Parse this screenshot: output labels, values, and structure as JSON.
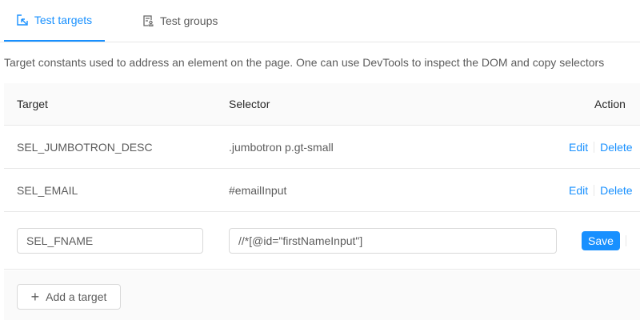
{
  "tabs": [
    {
      "label": "Test targets",
      "icon": "select-icon",
      "active": true
    },
    {
      "label": "Test groups",
      "icon": "profile-icon",
      "active": false
    }
  ],
  "description": "Target constants used to address an element on the page. One can use DevTools to inspect the DOM and copy selectors",
  "table": {
    "headers": {
      "target": "Target",
      "selector": "Selector",
      "action": "Action"
    },
    "rows": [
      {
        "target": "SEL_JUMBOTRON_DESC",
        "selector": ".jumbotron p.gt-small",
        "edit": "Edit",
        "delete": "Delete"
      },
      {
        "target": "SEL_EMAIL",
        "selector": "#emailInput",
        "edit": "Edit",
        "delete": "Delete"
      }
    ],
    "editing": {
      "target": "SEL_FNAME",
      "selector": "//*[@id=\"firstNameInput\"]",
      "save": "Save"
    }
  },
  "add_button": "Add a target",
  "colors": {
    "accent": "#1890ff"
  }
}
